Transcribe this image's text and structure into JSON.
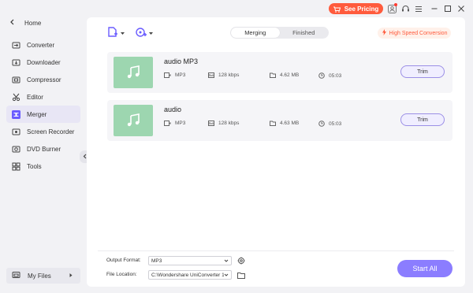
{
  "titlebar": {
    "pricing_label": "See Pricing"
  },
  "sidebar": {
    "home_label": "Home",
    "items": [
      {
        "label": "Converter",
        "icon": "converter-icon",
        "active": false
      },
      {
        "label": "Downloader",
        "icon": "downloader-icon",
        "active": false
      },
      {
        "label": "Compressor",
        "icon": "compressor-icon",
        "active": false
      },
      {
        "label": "Editor",
        "icon": "editor-icon",
        "active": false
      },
      {
        "label": "Merger",
        "icon": "merger-icon",
        "active": true
      },
      {
        "label": "Screen Recorder",
        "icon": "screen-recorder-icon",
        "active": false
      },
      {
        "label": "DVD Burner",
        "icon": "dvd-burner-icon",
        "active": false
      },
      {
        "label": "Tools",
        "icon": "tools-icon",
        "active": false
      }
    ],
    "my_files_label": "My Files"
  },
  "toolbar": {
    "tabs": [
      {
        "label": "Merging",
        "active": true
      },
      {
        "label": "Finished",
        "active": false
      }
    ],
    "high_speed_label": "High Speed Conversion"
  },
  "files": [
    {
      "title": "audio MP3",
      "format": "MP3",
      "bitrate": "128 kbps",
      "size": "4.62 MB",
      "duration": "05:03",
      "trim_label": "Trim"
    },
    {
      "title": "audio",
      "format": "MP3",
      "bitrate": "128 kbps",
      "size": "4.63 MB",
      "duration": "05:03",
      "trim_label": "Trim"
    }
  ],
  "footer": {
    "output_format_label": "Output Format:",
    "output_format_value": "MP3",
    "file_location_label": "File Location:",
    "file_location_value": "C:\\Wondershare UniConverter 1",
    "start_all_label": "Start All"
  },
  "colors": {
    "accent": "#8b7dff",
    "brand_orange": "#ff5b3d",
    "thumb_green": "#9dd6b0"
  }
}
